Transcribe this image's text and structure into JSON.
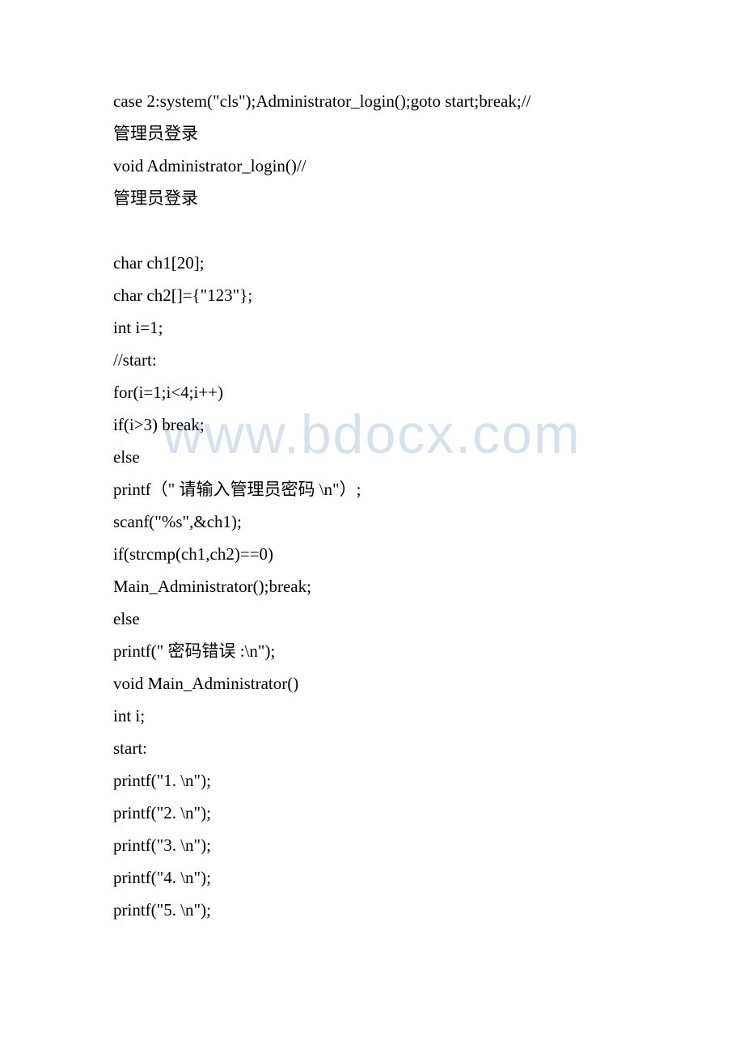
{
  "watermark": "www.bdocx.com",
  "lines": [
    "case 2:system(\"cls\");Administrator_login();goto start;break;//",
    "管理员登录",
    "void Administrator_login()//",
    "管理员登录",
    "",
    "char ch1[20];",
    "char ch2[]={\"123\"};",
    "int i=1;",
    "//start:",
    "for(i=1;i<4;i++)",
    "if(i>3) break;",
    "else",
    "printf（\" 请输入管理员密码 \\n\"）;",
    "scanf(\"%s\",&ch1);",
    "if(strcmp(ch1,ch2)==0)",
    "Main_Administrator();break;",
    "else",
    "printf(\" 密码错误 :\\n\");",
    "void Main_Administrator()",
    "int i;",
    "start:",
    "printf(\"1. \\n\");",
    "printf(\"2. \\n\");",
    "printf(\"3. \\n\");",
    "printf(\"4. \\n\");",
    "printf(\"5. \\n\");"
  ]
}
